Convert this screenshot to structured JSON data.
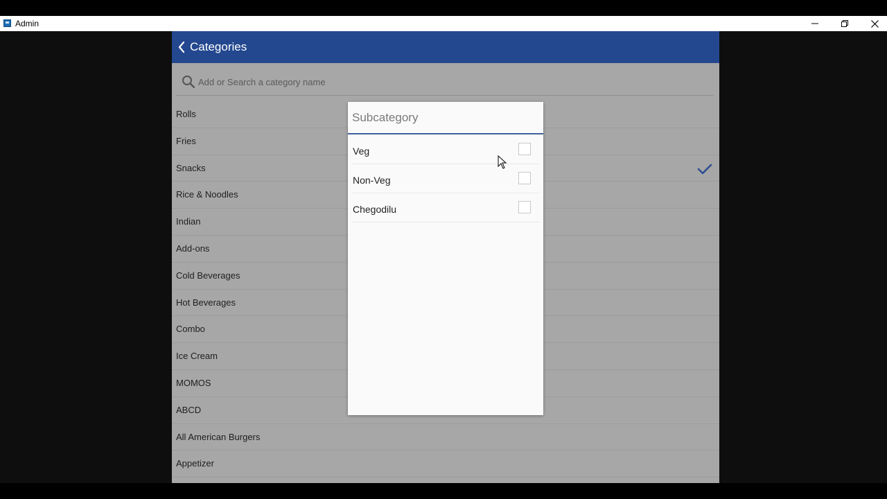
{
  "window": {
    "title": "Admin",
    "minimize_icon": "minimize-icon",
    "maximize_icon": "restore-icon",
    "close_icon": "close-icon"
  },
  "header": {
    "back_icon": "chevron-left-icon",
    "title": "Categories",
    "color": "#23488f"
  },
  "search": {
    "placeholder": "Add or Search a category name",
    "value": ""
  },
  "categories": [
    {
      "label": "Rolls",
      "checked": false
    },
    {
      "label": "Fries",
      "checked": false
    },
    {
      "label": "Snacks",
      "checked": true
    },
    {
      "label": "Rice & Noodles",
      "checked": false
    },
    {
      "label": "Indian",
      "checked": false
    },
    {
      "label": "Add-ons",
      "checked": false
    },
    {
      "label": "Cold Beverages",
      "checked": false
    },
    {
      "label": "Hot Beverages",
      "checked": false
    },
    {
      "label": "Combo",
      "checked": false
    },
    {
      "label": "Ice Cream",
      "checked": false
    },
    {
      "label": "MOMOS",
      "checked": false
    },
    {
      "label": "ABCD",
      "checked": false
    },
    {
      "label": "All American Burgers",
      "checked": false
    },
    {
      "label": "Appetizer",
      "checked": false
    }
  ],
  "subcategory_panel": {
    "title": "Subcategory",
    "items": [
      {
        "label": "Veg",
        "checked": false
      },
      {
        "label": "Non-Veg",
        "checked": false
      },
      {
        "label": "Chegodilu",
        "checked": false
      }
    ]
  },
  "colors": {
    "accent": "#23488f",
    "check": "#2f4f8f"
  }
}
